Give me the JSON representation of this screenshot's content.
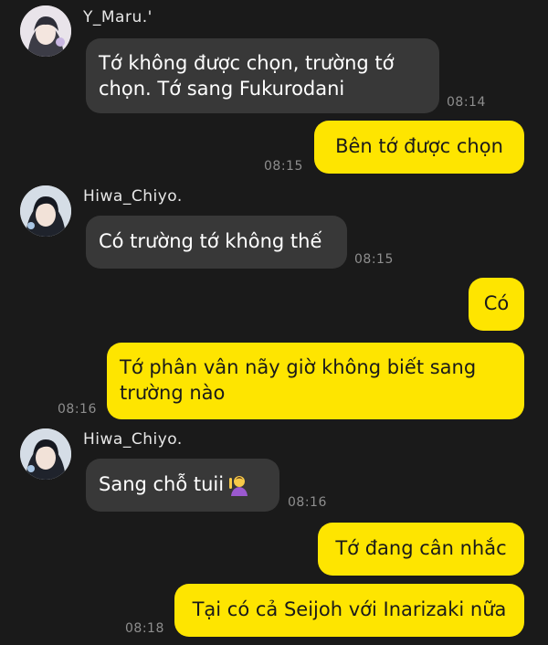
{
  "messages": [
    {
      "sender": "Y_Maru.'",
      "direction": "in",
      "text": "Tớ không được chọn,  trường tớ\nchọn.  Tớ sang Fukurodani",
      "time": "08:14"
    },
    {
      "direction": "out",
      "text": "Bên tớ được chọn",
      "time": "08:15"
    },
    {
      "sender": "Hiwa_Chiyo.",
      "direction": "in",
      "text": "Có trường tớ không thế",
      "time": "08:15"
    },
    {
      "direction": "out",
      "text": "Có",
      "time": ""
    },
    {
      "direction": "out",
      "text": "Tớ phân vân nãy giờ không biết sang\ntrường nào",
      "time": "08:16"
    },
    {
      "sender": "Hiwa_Chiyo.",
      "direction": "in",
      "text": "Sang chỗ tuii",
      "emoji": "person-raising-hand-emoji",
      "time": "08:16"
    },
    {
      "direction": "out",
      "text": "Tớ đang cân nhắc",
      "time": ""
    },
    {
      "direction": "out",
      "text": "Tại có cả Seijoh với Inarizaki nữa",
      "time": "08:18"
    }
  ],
  "colors": {
    "background": "#1a1a1a",
    "incoming_bubble": "#383838",
    "outgoing_bubble": "#fee500",
    "timestamp": "#8e8e8e"
  }
}
